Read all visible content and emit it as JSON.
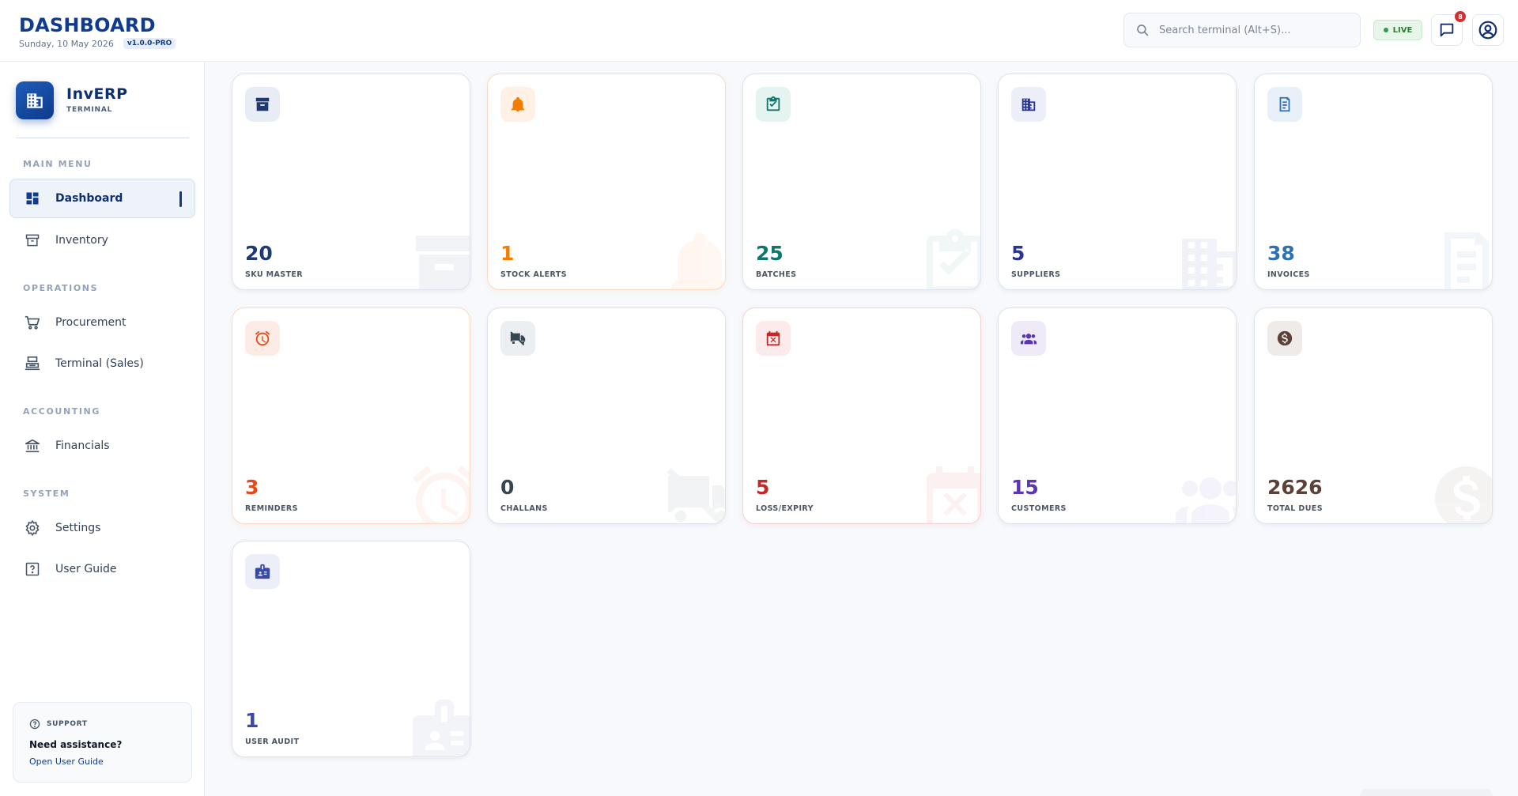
{
  "header": {
    "title": "DASHBOARD",
    "date": "Sunday, 10 May 2026",
    "version": "v1.0.0-PRO",
    "search_placeholder": "Search terminal (Alt+S)...",
    "live_label": "LIVE",
    "notification_count": "8"
  },
  "brand": {
    "name": "InvERP",
    "subtitle": "TERMINAL"
  },
  "sidebar": {
    "sections": [
      {
        "label": "MAIN MENU"
      },
      {
        "label": "OPERATIONS"
      },
      {
        "label": "ACCOUNTING"
      },
      {
        "label": "SYSTEM"
      }
    ],
    "items": [
      {
        "label": "Dashboard",
        "icon": "dashboard-icon",
        "active": true
      },
      {
        "label": "Inventory",
        "icon": "archive-icon"
      },
      {
        "label": "Procurement",
        "icon": "cart-icon"
      },
      {
        "label": "Terminal (Sales)",
        "icon": "register-icon"
      },
      {
        "label": "Financials",
        "icon": "bank-icon"
      },
      {
        "label": "Settings",
        "icon": "gear-icon"
      },
      {
        "label": "User Guide",
        "icon": "help-box-icon"
      }
    ]
  },
  "support": {
    "label": "SUPPORT",
    "question": "Need assistance?",
    "link": "Open User Guide"
  },
  "cards": [
    {
      "value": "20",
      "label": "SKU MASTER",
      "icon": "archive-icon",
      "color": "#1f3a73",
      "icon_bg": "#e8edf5",
      "icon_color": "#1f3a73"
    },
    {
      "value": "1",
      "label": "STOCK ALERTS",
      "icon": "bell-icon",
      "color": "#f57c00",
      "icon_bg": "#fff1e6",
      "icon_color": "#f57c00"
    },
    {
      "value": "25",
      "label": "BATCHES",
      "icon": "clipboard-check-icon",
      "color": "#0f766e",
      "icon_bg": "#e6f4f1",
      "icon_color": "#0f766e"
    },
    {
      "value": "5",
      "label": "SUPPLIERS",
      "icon": "building-icon",
      "color": "#283593",
      "icon_bg": "#eceef8",
      "icon_color": "#283593"
    },
    {
      "value": "38",
      "label": "INVOICES",
      "icon": "receipt-icon",
      "color": "#2f6fb3",
      "icon_bg": "#e8f1fa",
      "icon_color": "#2f6fb3"
    },
    {
      "value": "3",
      "label": "REMINDERS",
      "icon": "alarm-icon",
      "color": "#e64a19",
      "icon_bg": "#fdece6",
      "icon_color": "#e64a19"
    },
    {
      "value": "0",
      "label": "CHALLANS",
      "icon": "truck-off-icon",
      "color": "#37474f",
      "icon_bg": "#eceff1",
      "icon_color": "#37474f"
    },
    {
      "value": "5",
      "label": "LOSS/EXPIRY",
      "icon": "calendar-x-icon",
      "color": "#c62828",
      "icon_bg": "#fdeaea",
      "icon_color": "#c62828"
    },
    {
      "value": "15",
      "label": "CUSTOMERS",
      "icon": "people-icon",
      "color": "#5e35b1",
      "icon_bg": "#efeaf8",
      "icon_color": "#5e35b1"
    },
    {
      "value": "2626",
      "label": "TOTAL DUES",
      "icon": "dollar-circle-icon",
      "color": "#5d4037",
      "icon_bg": "#efebe9",
      "icon_color": "#5d4037"
    },
    {
      "value": "1",
      "label": "USER AUDIT",
      "icon": "badge-icon",
      "color": "#3949ab",
      "icon_bg": "#eceef8",
      "icon_color": "#3949ab"
    }
  ]
}
